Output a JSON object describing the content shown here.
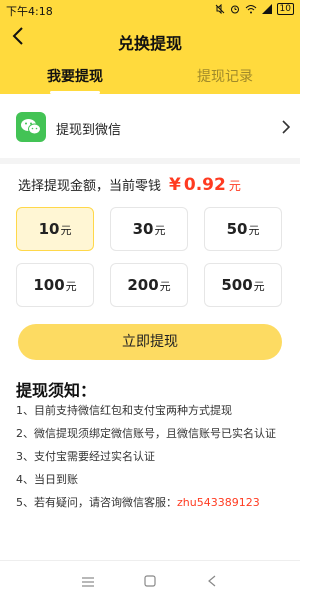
{
  "status_bar": {
    "time": "下午4:18",
    "battery": "10"
  },
  "nav": {
    "title": "兑换提现"
  },
  "tabs": [
    {
      "label": "我要提现",
      "active": true
    },
    {
      "label": "提现记录",
      "active": false
    }
  ],
  "method": {
    "label": "提现到微信",
    "icon": "wechat-icon"
  },
  "amount": {
    "prompt": "选择提现金额，当前零钱",
    "currency_symbol": "¥",
    "balance": "0.92",
    "unit": "元"
  },
  "options": [
    {
      "value": "10",
      "unit": "元",
      "selected": true
    },
    {
      "value": "30",
      "unit": "元",
      "selected": false
    },
    {
      "value": "50",
      "unit": "元",
      "selected": false
    },
    {
      "value": "100",
      "unit": "元",
      "selected": false
    },
    {
      "value": "200",
      "unit": "元",
      "selected": false
    },
    {
      "value": "500",
      "unit": "元",
      "selected": false
    }
  ],
  "confirm_label": "立即提现",
  "notes": {
    "title": "提现须知：",
    "items": [
      "1、目前支持微信红包和支付宝两种方式提现",
      "2、微信提现须绑定微信账号，且微信账号已实名认证",
      "3、支付宝需要经过实名认证",
      "4、当日到账"
    ],
    "contact_prefix": "5、若有疑问，请咨询微信客服：",
    "contact_id": "zhu543389123"
  },
  "colors": {
    "header_yellow": "#ffda3d",
    "accent_red": "#ff3b21",
    "wechat_green": "#43c355",
    "button_yellow": "#fddb62",
    "selected_bg": "#fff6d4"
  }
}
